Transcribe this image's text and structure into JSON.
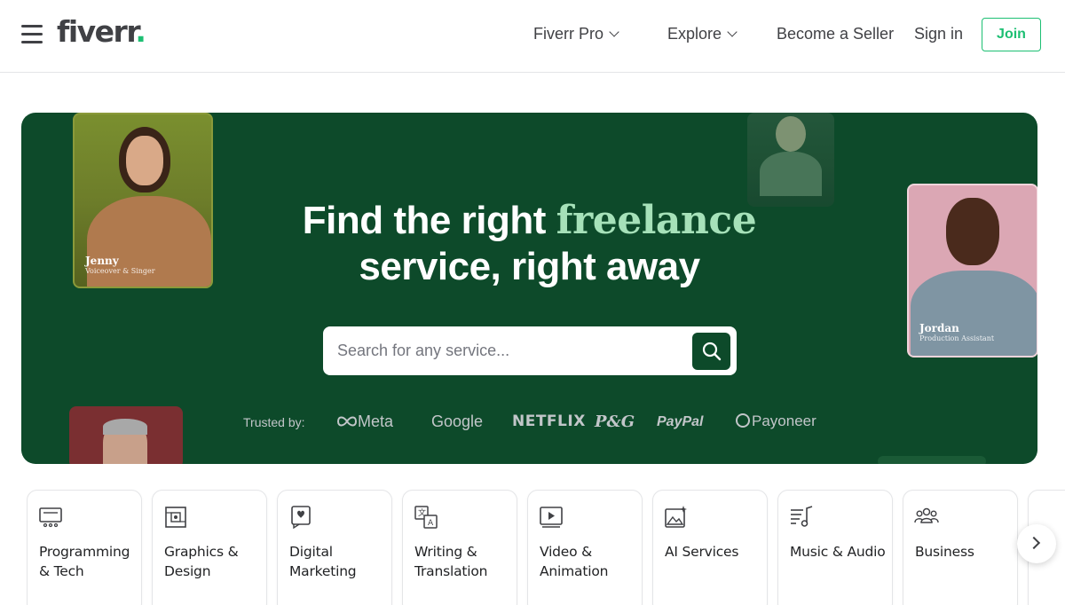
{
  "header": {
    "logo": "fiverr",
    "logo_dot": ".",
    "nav": {
      "fiverr_pro": "Fiverr Pro",
      "explore": "Explore",
      "become_seller": "Become a Seller",
      "sign_in": "Sign in",
      "join": "Join"
    }
  },
  "hero": {
    "title_part1": "Find the right ",
    "title_highlight": "freelance",
    "title_part2": "service, right away",
    "search": {
      "placeholder": "Search for any service..."
    },
    "trusted_by": {
      "label": "Trusted by:",
      "brands": [
        "Meta",
        "Google",
        "NETFLIX",
        "P&G",
        "PayPal",
        "Payoneer"
      ]
    },
    "profile_cards": [
      {
        "name": "Jenny",
        "role": "Voiceover & Singer"
      },
      {
        "name": "Jordan",
        "role": "Production Assistant"
      }
    ]
  },
  "categories": [
    {
      "label": "Programming & Tech",
      "icon": "monitor-icon"
    },
    {
      "label": "Graphics & Design",
      "icon": "design-frame-icon"
    },
    {
      "label": "Digital Marketing",
      "icon": "marketing-icon"
    },
    {
      "label": "Writing & Translation",
      "icon": "translation-icon"
    },
    {
      "label": "Video & Animation",
      "icon": "video-icon"
    },
    {
      "label": "AI Services",
      "icon": "ai-image-icon"
    },
    {
      "label": "Music & Audio",
      "icon": "music-icon"
    },
    {
      "label": "Business",
      "icon": "people-icon"
    }
  ],
  "colors": {
    "brand_green": "#1dbf73",
    "hero_bg": "#0d4a2a",
    "highlight": "#a6e1b9"
  }
}
